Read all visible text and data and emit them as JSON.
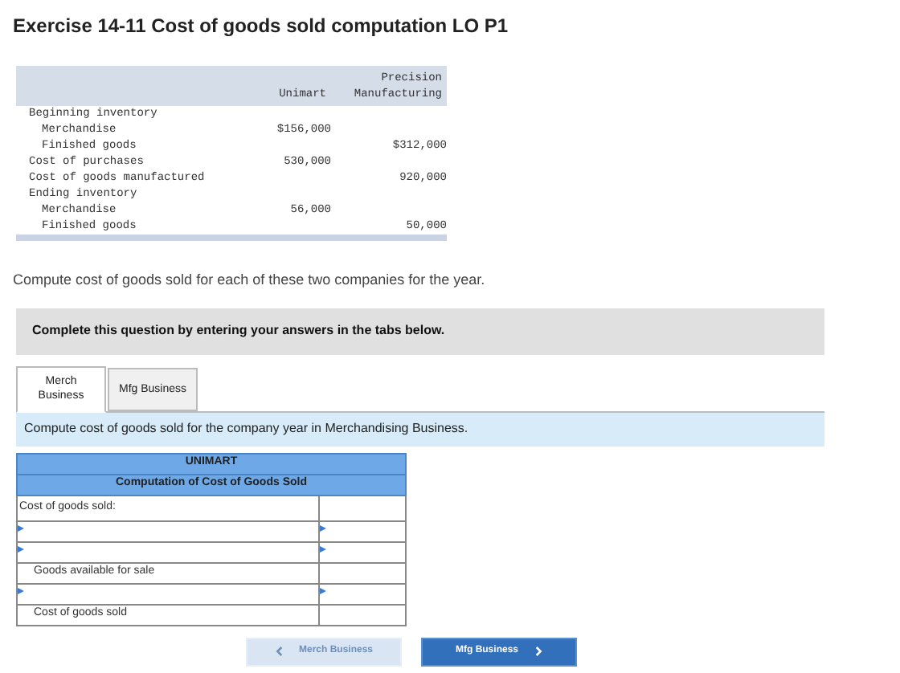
{
  "title": "Exercise 14-11 Cost of goods sold computation LO P1",
  "data_table": {
    "columns": [
      "",
      "Unimart",
      "Precision Manufacturing"
    ],
    "rows": [
      {
        "label": "Beginning inventory",
        "children": [
          {
            "label": "Merchandise",
            "unimart": "$156,000"
          },
          {
            "label": "Finished goods",
            "precision": "$312,000"
          }
        ]
      },
      {
        "label": "Cost of purchases",
        "unimart": "530,000"
      },
      {
        "label": "Cost of goods manufactured",
        "precision": "920,000"
      },
      {
        "label": "Ending inventory",
        "children": [
          {
            "label": "Merchandise",
            "unimart": "56,000"
          },
          {
            "label": "Finished goods",
            "precision": "50,000"
          }
        ]
      }
    ]
  },
  "prompt": "Compute cost of goods sold for each of these two companies for the year.",
  "instruction": "Complete this question by entering your answers in the tabs below.",
  "tabs": [
    {
      "label": "Merch Business",
      "selected": true
    },
    {
      "label": "Mfg Business",
      "selected": false
    }
  ],
  "task": "Compute cost of goods sold for the company year in Merchandising Business.",
  "worksheet": {
    "title": "UNIMART",
    "subtitle": "Computation of Cost of Goods Sold",
    "rows": [
      {
        "kind": "heading",
        "label": "Cost of goods sold:"
      },
      {
        "kind": "input"
      },
      {
        "kind": "input"
      },
      {
        "kind": "total",
        "label": "Goods available for sale"
      },
      {
        "kind": "input"
      },
      {
        "kind": "total",
        "label": "Cost of goods sold"
      }
    ]
  },
  "nav": [
    {
      "label": "Merch Business",
      "kind": "prev",
      "disabled": true
    },
    {
      "label": "Mfg Business",
      "kind": "next",
      "disabled": false
    }
  ]
}
